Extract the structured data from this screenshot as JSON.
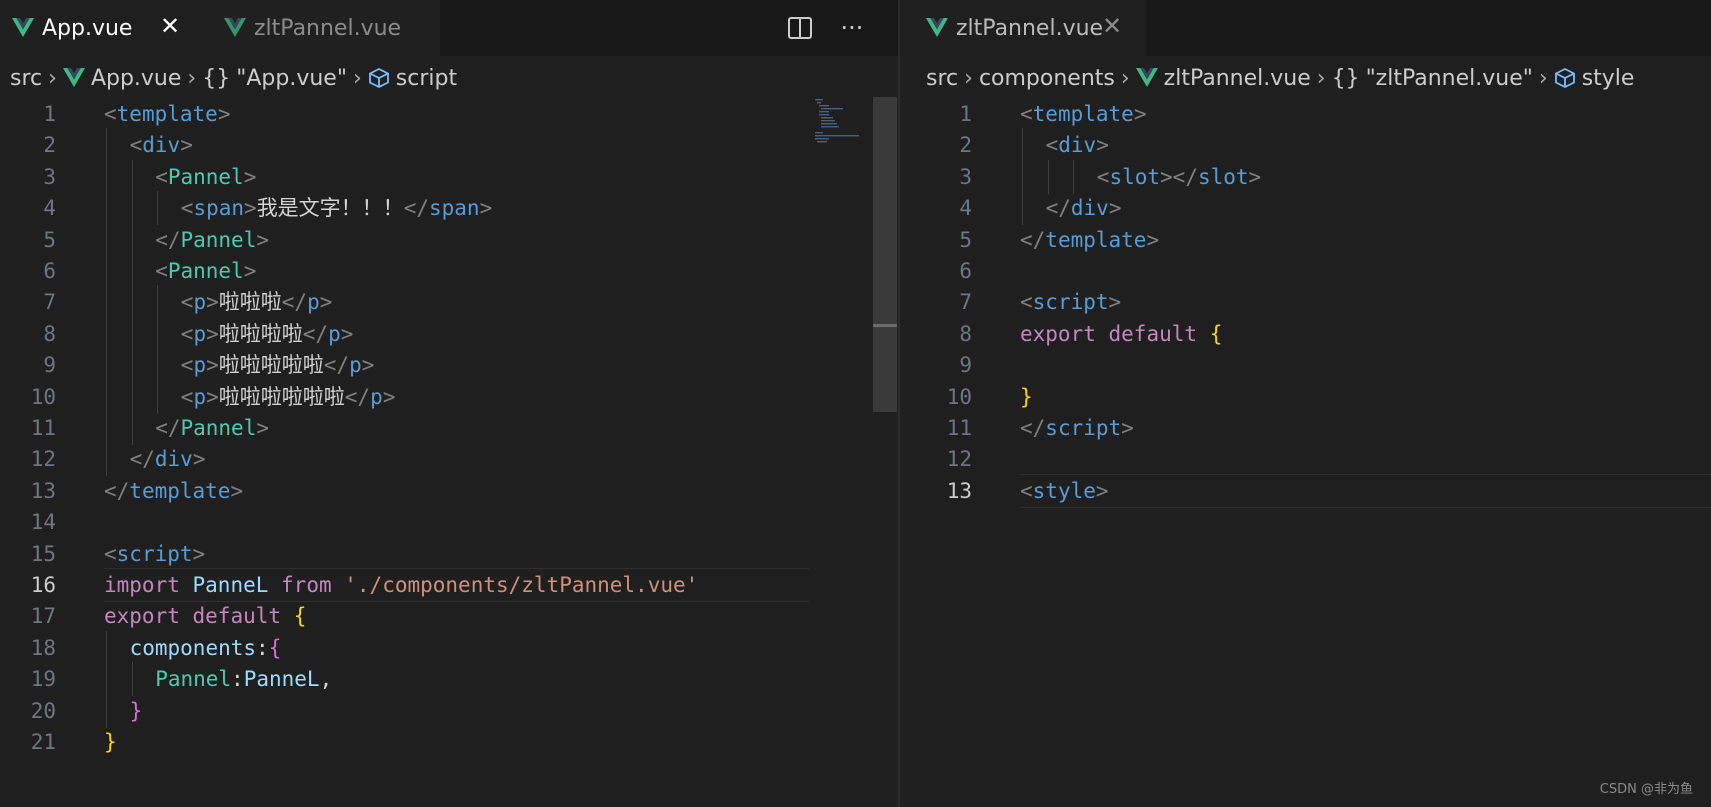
{
  "left": {
    "tabs": [
      {
        "label": "App.vue",
        "active": true,
        "close": "✕"
      },
      {
        "label": "zltPannel.vue",
        "active": false
      }
    ],
    "breadcrumb": {
      "src": "src",
      "file": "App.vue",
      "object": "\"App.vue\"",
      "symbol": "script"
    },
    "actions": {
      "split": "split-editor-icon",
      "more": "···"
    },
    "current_line": 16
  },
  "right": {
    "tabs": [
      {
        "label": "zltPannel.vue",
        "active": true,
        "close": "✕"
      }
    ],
    "breadcrumb": {
      "src": "src",
      "folder": "components",
      "file": "zltPannel.vue",
      "object": "\"zltPannel.vue\"",
      "symbol": "style"
    },
    "current_line": 13
  },
  "watermark": "CSDN @非为鱼",
  "colors": {
    "tag": "#569cd6",
    "component": "#4ec9b0",
    "keyword": "#c586c0",
    "string": "#ce9178",
    "variable": "#9cdcfe",
    "vue_green": "#41b883"
  },
  "left_code": [
    [
      [
        "<",
        "punc"
      ],
      [
        "template",
        "tag"
      ],
      [
        ">",
        "punc"
      ]
    ],
    [
      [
        "<",
        "punc"
      ],
      [
        "div",
        "tag"
      ],
      [
        ">",
        "punc"
      ]
    ],
    [
      [
        "<",
        "punc"
      ],
      [
        "Pannel",
        "comp"
      ],
      [
        ">",
        "punc"
      ]
    ],
    [
      [
        "<",
        "punc"
      ],
      [
        "span",
        "tag"
      ],
      [
        ">",
        "punc"
      ],
      [
        "我是文字！！！",
        "text"
      ],
      [
        "</",
        "punc"
      ],
      [
        "span",
        "tag"
      ],
      [
        ">",
        "punc"
      ]
    ],
    [
      [
        "</",
        "punc"
      ],
      [
        "Pannel",
        "comp"
      ],
      [
        ">",
        "punc"
      ]
    ],
    [
      [
        "<",
        "punc"
      ],
      [
        "Pannel",
        "comp"
      ],
      [
        ">",
        "punc"
      ]
    ],
    [
      [
        "<",
        "punc"
      ],
      [
        "p",
        "tag"
      ],
      [
        ">",
        "punc"
      ],
      [
        "啦啦啦",
        "text"
      ],
      [
        "</",
        "punc"
      ],
      [
        "p",
        "tag"
      ],
      [
        ">",
        "punc"
      ]
    ],
    [
      [
        "<",
        "punc"
      ],
      [
        "p",
        "tag"
      ],
      [
        ">",
        "punc"
      ],
      [
        "啦啦啦啦",
        "text"
      ],
      [
        "</",
        "punc"
      ],
      [
        "p",
        "tag"
      ],
      [
        ">",
        "punc"
      ]
    ],
    [
      [
        "<",
        "punc"
      ],
      [
        "p",
        "tag"
      ],
      [
        ">",
        "punc"
      ],
      [
        "啦啦啦啦啦",
        "text"
      ],
      [
        "</",
        "punc"
      ],
      [
        "p",
        "tag"
      ],
      [
        ">",
        "punc"
      ]
    ],
    [
      [
        "<",
        "punc"
      ],
      [
        "p",
        "tag"
      ],
      [
        ">",
        "punc"
      ],
      [
        "啦啦啦啦啦啦",
        "text"
      ],
      [
        "</",
        "punc"
      ],
      [
        "p",
        "tag"
      ],
      [
        ">",
        "punc"
      ]
    ],
    [
      [
        "</",
        "punc"
      ],
      [
        "Pannel",
        "comp"
      ],
      [
        ">",
        "punc"
      ]
    ],
    [
      [
        "</",
        "punc"
      ],
      [
        "div",
        "tag"
      ],
      [
        ">",
        "punc"
      ]
    ],
    [
      [
        "</",
        "punc"
      ],
      [
        "template",
        "tag"
      ],
      [
        ">",
        "punc"
      ]
    ],
    [],
    [
      [
        "<",
        "punc"
      ],
      [
        "script",
        "tag"
      ],
      [
        ">",
        "punc"
      ]
    ],
    [
      [
        "import",
        "key"
      ],
      [
        " ",
        "text"
      ],
      [
        "PanneL",
        "var"
      ],
      [
        " ",
        "text"
      ],
      [
        "from",
        "key"
      ],
      [
        " ",
        "text"
      ],
      [
        "'./components/zltPannel.vue'",
        "str"
      ]
    ],
    [
      [
        "export",
        "key"
      ],
      [
        " ",
        "text"
      ],
      [
        "default",
        "key"
      ],
      [
        " ",
        "text"
      ],
      [
        "{",
        "brace"
      ]
    ],
    [
      [
        "components",
        "var"
      ],
      [
        ":",
        "text"
      ],
      [
        "{",
        "brace2"
      ]
    ],
    [
      [
        "Pannel",
        "comp"
      ],
      [
        ":",
        "text"
      ],
      [
        "PanneL",
        "var"
      ],
      [
        ",",
        "text"
      ]
    ],
    [
      [
        "}",
        "brace2"
      ]
    ],
    [
      [
        "}",
        "brace"
      ]
    ]
  ],
  "right_code": [
    [
      [
        "<",
        "punc"
      ],
      [
        "template",
        "tag"
      ],
      [
        ">",
        "punc"
      ]
    ],
    [
      [
        "<",
        "punc"
      ],
      [
        "div",
        "tag"
      ],
      [
        ">",
        "punc"
      ]
    ],
    [
      [
        "<",
        "punc"
      ],
      [
        "slot",
        "tag"
      ],
      [
        "></",
        "punc"
      ],
      [
        "slot",
        "tag"
      ],
      [
        ">",
        "punc"
      ]
    ],
    [
      [
        "</",
        "punc"
      ],
      [
        "div",
        "tag"
      ],
      [
        ">",
        "punc"
      ]
    ],
    [
      [
        "</",
        "punc"
      ],
      [
        "template",
        "tag"
      ],
      [
        ">",
        "punc"
      ]
    ],
    [],
    [
      [
        "<",
        "punc"
      ],
      [
        "script",
        "tag"
      ],
      [
        ">",
        "punc"
      ]
    ],
    [
      [
        "export",
        "key"
      ],
      [
        " ",
        "text"
      ],
      [
        "default",
        "key"
      ],
      [
        " ",
        "text"
      ],
      [
        "{",
        "brace"
      ]
    ],
    [],
    [
      [
        "}",
        "brace"
      ]
    ],
    [
      [
        "</",
        "punc"
      ],
      [
        "script",
        "tag"
      ],
      [
        ">",
        "punc"
      ]
    ],
    [],
    [
      [
        "<",
        "punc"
      ],
      [
        "style",
        "tag"
      ],
      [
        ">",
        "punc"
      ]
    ]
  ]
}
